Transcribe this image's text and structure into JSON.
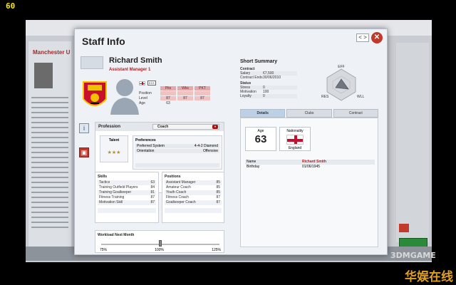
{
  "fps": "60",
  "background": {
    "club_title": "Manchester U"
  },
  "dialog": {
    "title": "Staff Info",
    "nav_label": "< >",
    "close_label": "✕"
  },
  "staff": {
    "name": "Richard Smith",
    "role": "Assistant Manager 1",
    "number": "E1S",
    "attr_headers": [
      "Pits",
      "Wks",
      "PKT"
    ],
    "attributes": [
      {
        "label": "Position",
        "values": [
          "",
          "",
          ""
        ]
      },
      {
        "label": "Level",
        "values": [
          "87",
          "87",
          "87"
        ]
      },
      {
        "label": "Age",
        "values": [
          "63",
          "",
          ""
        ]
      }
    ]
  },
  "profession": {
    "title": "Profession",
    "selected": "Coach",
    "talent_label": "Talent",
    "talent_stars": "★★★",
    "preferences_title": "Preferences",
    "preferences": [
      {
        "label": "Preferred System",
        "value": "4-4-2 Diamond"
      },
      {
        "label": "Orientation",
        "value": "Offensive"
      }
    ]
  },
  "skills": {
    "title": "Skills",
    "rows": [
      {
        "label": "Tactics",
        "value": "63"
      },
      {
        "label": "Training Outfield Players",
        "value": "84"
      },
      {
        "label": "Training Goalkeeper",
        "value": "81"
      },
      {
        "label": "Fitness Training",
        "value": "87"
      },
      {
        "label": "Motivation Skill",
        "value": "87"
      }
    ]
  },
  "positions": {
    "title": "Positions",
    "rows": [
      {
        "label": "Assistant Manager",
        "value": "85"
      },
      {
        "label": "Amateur Coach",
        "value": "85"
      },
      {
        "label": "Youth Coach",
        "value": "85"
      },
      {
        "label": "Fitness Coach",
        "value": "87"
      },
      {
        "label": "Goalkeeper Coach",
        "value": "87"
      }
    ]
  },
  "workload": {
    "title": "Workload Next Month",
    "min_label": "75%",
    "mid_label": "100%",
    "max_label": "125%",
    "value_percent": 100
  },
  "summary": {
    "title": "Short Summary",
    "contract_title": "Contract",
    "contract": [
      {
        "label": "Salary",
        "value": "€7,500"
      },
      {
        "label": "Contract Ends",
        "value": "30/06/2010"
      }
    ],
    "status_title": "Status",
    "status": [
      {
        "label": "Stress",
        "value": "0"
      },
      {
        "label": "Motivation",
        "value": "100"
      },
      {
        "label": "Loyalty",
        "value": "0"
      }
    ],
    "radar_labels": [
      "EFF",
      "RES",
      "WLL"
    ]
  },
  "tabs": [
    "Details",
    "Clubs",
    "Contract"
  ],
  "details": {
    "age_label": "Age",
    "age_value": "63",
    "nationality_label": "Nationality",
    "nationality_value": "England",
    "rows": [
      {
        "label": "Name",
        "value": "Richard Smith"
      },
      {
        "label": "Birthday",
        "value": "01/06/1945"
      }
    ]
  },
  "watermark": {
    "brand": "3DMGAME",
    "brand_cn": "华娱在线"
  },
  "colors": {
    "accent_red": "#c0392b",
    "role_red": "#b02020",
    "star_gold": "#b88f2a"
  }
}
